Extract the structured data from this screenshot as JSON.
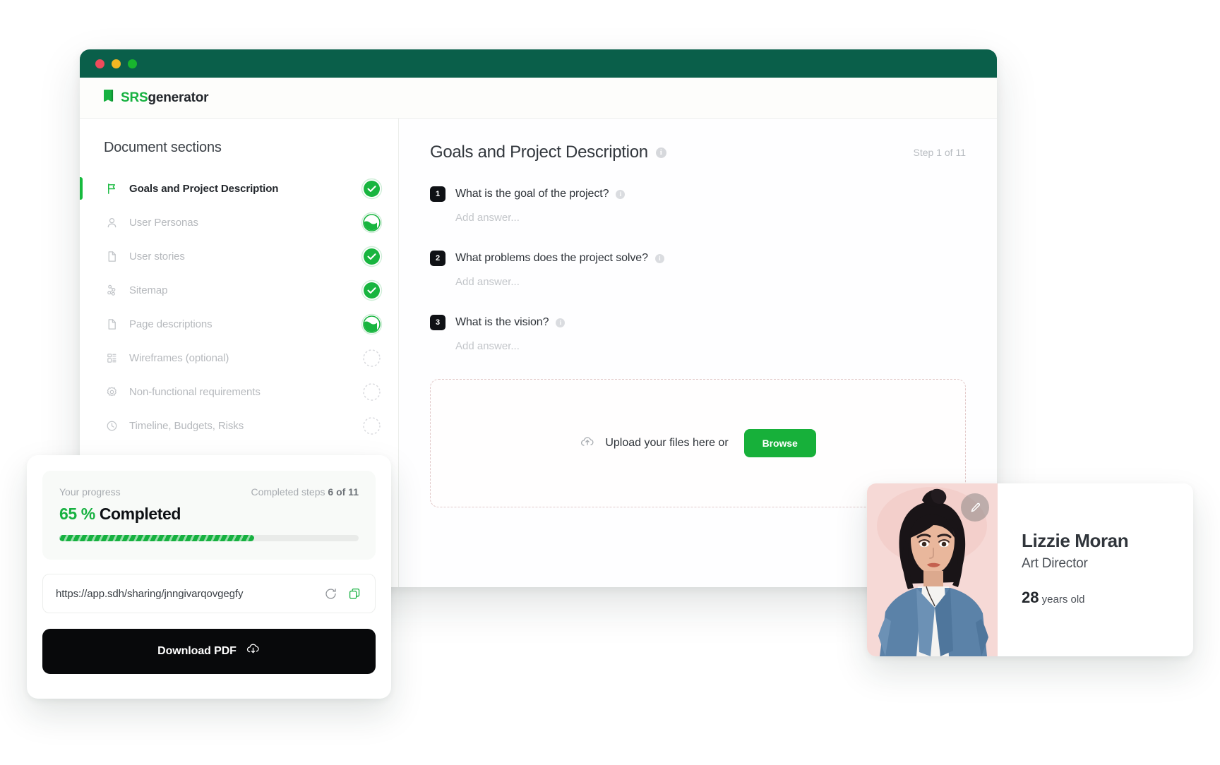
{
  "window": {
    "traffic_lights": [
      "close",
      "minimize",
      "maximize"
    ],
    "brand_prefix": "SRS",
    "brand_suffix": "generator",
    "brand_icon": "book-icon"
  },
  "sidebar": {
    "title": "Document sections",
    "items": [
      {
        "label": "Goals and Project Description",
        "icon": "flag-icon",
        "status": "complete",
        "active": true
      },
      {
        "label": "User Personas",
        "icon": "user-icon",
        "status": "partial",
        "active": false
      },
      {
        "label": "User stories",
        "icon": "file-icon",
        "status": "complete",
        "active": false
      },
      {
        "label": "Sitemap",
        "icon": "sitemap-icon",
        "status": "complete",
        "active": false
      },
      {
        "label": "Page descriptions",
        "icon": "file-icon",
        "status": "partial",
        "active": false
      },
      {
        "label": "Wireframes (optional)",
        "icon": "wireframe-icon",
        "status": "empty",
        "active": false
      },
      {
        "label": "Non-functional requirements",
        "icon": "gear-icon",
        "status": "empty",
        "active": false
      },
      {
        "label": "Timeline, Budgets, Risks",
        "icon": "clock-icon",
        "status": "empty",
        "active": false
      }
    ]
  },
  "main": {
    "title": "Goals and Project Description",
    "title_info_icon": "info-icon",
    "step_label": "Step 1 of 11",
    "questions": [
      {
        "num": "1",
        "text": "What is the goal of the project?",
        "answer_placeholder": "Add answer...",
        "info_icon": "info-icon"
      },
      {
        "num": "2",
        "text": "What problems does the project solve?",
        "answer_placeholder": "Add answer...",
        "info_icon": "info-icon"
      },
      {
        "num": "3",
        "text": "What is the vision?",
        "answer_placeholder": "Add answer...",
        "info_icon": "info-icon"
      }
    ],
    "upload": {
      "icon": "cloud-upload-icon",
      "text": "Upload your files here or",
      "button_label": "Browse"
    }
  },
  "progress_card": {
    "label": "Your progress",
    "steps_prefix": "Completed steps",
    "steps_value": "6 of 11",
    "percent": "65 %",
    "percent_word": "Completed",
    "percent_value": 65,
    "share_url": "https://app.sdh/sharing/jnngivarqovgegfy",
    "refresh_icon": "refresh-icon",
    "copy_icon": "copy-icon",
    "download_label": "Download PDF",
    "download_icon": "cloud-download-icon"
  },
  "persona": {
    "name": "Lizzie Moran",
    "role": "Art Director",
    "age_number": "28",
    "age_suffix": "years old",
    "edit_icon": "pencil-icon"
  },
  "colors": {
    "brand_green": "#16b140",
    "titlebar": "#0a5f4a",
    "dark": "#08090b",
    "muted": "#b6b9bd"
  }
}
